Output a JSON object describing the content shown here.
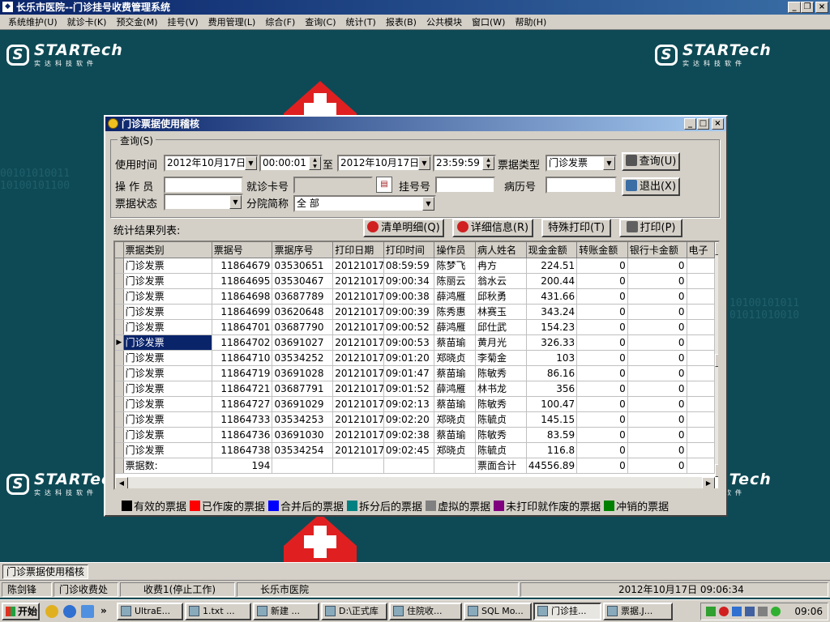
{
  "app": {
    "title": "长乐市医院--门诊挂号收费管理系统"
  },
  "menu": [
    "系统维护(U)",
    "就诊卡(K)",
    "预交金(M)",
    "挂号(V)",
    "费用管理(L)",
    "综合(F)",
    "查询(C)",
    "统计(T)",
    "报表(B)",
    "公共模块",
    "窗口(W)",
    "帮助(H)"
  ],
  "brand": {
    "name": "STARTech",
    "cn": "实达科技软件"
  },
  "dialog": {
    "title": "门诊票据使用稽核",
    "query_group": "查询(S)",
    "time_label": "使用时间",
    "start_date": "2012年10月17日",
    "start_time": "00:00:01",
    "to_label": "至",
    "end_date": "2012年10月17日",
    "end_time": "23:59:59",
    "ticket_type_label": "票据类型",
    "ticket_type": "门诊发票",
    "query_btn": "查询(U)",
    "exit_btn": "退出(X)",
    "operator_label": "操 作 员",
    "operator": "",
    "card_label": "就诊卡号",
    "card": "",
    "reg_label": "挂号号",
    "reg": "",
    "record_label": "病历号",
    "record": "",
    "status_label": "票据状态",
    "status": "",
    "branch_label": "分院简称",
    "branch": "全 部",
    "result_label": "统计结果列表:",
    "clear_btn": "清单明细(Q)",
    "detail_btn": "详细信息(R)",
    "special_print_btn": "特殊打印(T)",
    "print_btn": "打印(P)"
  },
  "table": {
    "columns": [
      "票据类别",
      "票据号",
      "票据序号",
      "打印日期",
      "打印时间",
      "操作员",
      "病人姓名",
      "现金金额",
      "转账金额",
      "银行卡金额",
      "电子"
    ],
    "rows": [
      [
        "门诊发票",
        "11864679",
        "03530651",
        "20121017",
        "08:59:59",
        "陈梦飞",
        "冉方",
        "224.51",
        "0",
        "0"
      ],
      [
        "门诊发票",
        "11864695",
        "03530467",
        "20121017",
        "09:00:34",
        "陈丽云",
        "翁水云",
        "200.44",
        "0",
        "0"
      ],
      [
        "门诊发票",
        "11864698",
        "03687789",
        "20121017",
        "09:00:38",
        "薛鸿雁",
        "邱秋勇",
        "431.66",
        "0",
        "0"
      ],
      [
        "门诊发票",
        "11864699",
        "03620648",
        "20121017",
        "09:00:39",
        "陈秀惠",
        "林赛玉",
        "343.24",
        "0",
        "0"
      ],
      [
        "门诊发票",
        "11864701",
        "03687790",
        "20121017",
        "09:00:52",
        "薛鸿雁",
        "邱仕武",
        "154.23",
        "0",
        "0"
      ],
      [
        "门诊发票",
        "11864702",
        "03691027",
        "20121017",
        "09:00:53",
        "蔡苗瑜",
        "黄月光",
        "326.33",
        "0",
        "0"
      ],
      [
        "门诊发票",
        "11864710",
        "03534252",
        "20121017",
        "09:01:20",
        "郑晓贞",
        "李菊金",
        "103",
        "0",
        "0"
      ],
      [
        "门诊发票",
        "11864719",
        "03691028",
        "20121017",
        "09:01:47",
        "蔡苗瑜",
        "陈敏秀",
        "86.16",
        "0",
        "0"
      ],
      [
        "门诊发票",
        "11864721",
        "03687791",
        "20121017",
        "09:01:52",
        "薛鸿雁",
        "林书龙",
        "356",
        "0",
        "0"
      ],
      [
        "门诊发票",
        "11864727",
        "03691029",
        "20121017",
        "09:02:13",
        "蔡苗瑜",
        "陈敏秀",
        "100.47",
        "0",
        "0"
      ],
      [
        "门诊发票",
        "11864733",
        "03534253",
        "20121017",
        "09:02:20",
        "郑晓贞",
        "陈毓贞",
        "145.15",
        "0",
        "0"
      ],
      [
        "门诊发票",
        "11864736",
        "03691030",
        "20121017",
        "09:02:38",
        "蔡苗瑜",
        "陈敏秀",
        "83.59",
        "0",
        "0"
      ],
      [
        "门诊发票",
        "11864738",
        "03534254",
        "20121017",
        "09:02:45",
        "郑晓贞",
        "陈毓贞",
        "116.8",
        "0",
        "0"
      ]
    ],
    "selected_row": 5,
    "footer": {
      "count_label": "票据数:",
      "count": "194",
      "sum_label": "票面合计",
      "sum": "44556.89",
      "transfer": "0",
      "bank": "0"
    }
  },
  "legend": [
    {
      "label": "有效的票据",
      "color": "#000000"
    },
    {
      "label": "已作废的票据",
      "color": "#ff0000"
    },
    {
      "label": "合并后的票据",
      "color": "#0000ff"
    },
    {
      "label": "拆分后的票据",
      "color": "#008080"
    },
    {
      "label": "虚拟的票据",
      "color": "#808080"
    },
    {
      "label": "未打印就作废的票据",
      "color": "#800080"
    },
    {
      "label": "冲销的票据",
      "color": "#008000"
    }
  ],
  "mdi_tab": "门诊票据使用稽核",
  "status": {
    "user": "陈剑锋",
    "dept": "门诊收费处",
    "station": "收费1(停止工作)",
    "hospital": "长乐市医院",
    "datetime": "2012年10月17日 09:06:34"
  },
  "taskbar": {
    "start": "开始",
    "buttons": [
      "UltraE...",
      "1.txt ...",
      "新建 ...",
      "D:\\正式库",
      "住院收...",
      "SQL Mo...",
      "门诊挂...",
      "票据.J..."
    ],
    "active": 6,
    "clock": "09:06"
  }
}
